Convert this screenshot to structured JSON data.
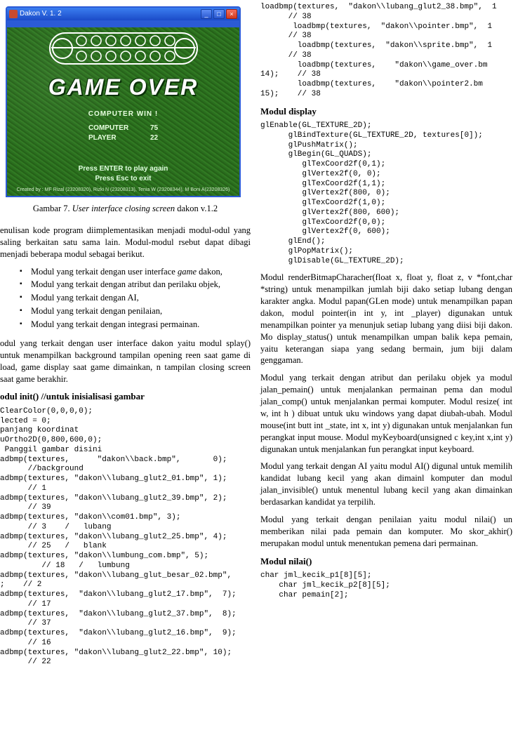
{
  "window": {
    "title": "Dakon V. 1. 2",
    "btn_min": "_",
    "btn_max": "□",
    "btn_close": "×"
  },
  "game": {
    "over": "GAME OVER",
    "winmsg": "COMPUTER WIN !",
    "score_labels": {
      "computer": "COMPUTER",
      "player": "PLAYER"
    },
    "scores": {
      "computer": "75",
      "player": "22"
    },
    "prompt1": "Press ENTER to play again",
    "prompt2": "Press Esc to exit",
    "credits": "Created by : MF Rizal (23208320), Rizki N (23208313), Tenia W (23208344), M Boni A(23208326)"
  },
  "caption_label": "Gambar 7.  ",
  "caption_text": "User interface closing screen",
  "caption_suffix": " dakon v.1.2",
  "para_intro": "enulisan kode program diimplementasikan menjadi modul-odul yang saling berkaitan satu sama lain. Modul-modul rsebut dapat dibagi menjadi beberapa modul sebagai berikut.",
  "bullets": [
    {
      "pre": "Modul yang terkait dengan user interface ",
      "ital": "game",
      "post": " dakon,"
    },
    {
      "pre": "Modul yang terkait dengan atribut dan perilaku objek,",
      "ital": "",
      "post": ""
    },
    {
      "pre": "Modul yang terkait dengan AI,",
      "ital": "",
      "post": ""
    },
    {
      "pre": "Modul yang terkait dengan penilaian,",
      "ital": "",
      "post": ""
    },
    {
      "pre": "Modul yang terkait dengan integrasi permainan.",
      "ital": "",
      "post": ""
    }
  ],
  "para_ui": "odul yang terkait dengan user interface dakon yaitu modul splay() untuk menampilkan background tampilan opening reen saat game di load, game display saat game dimainkan, n tampilan closing screen saat game berakhir.",
  "heading_init": "odul init() //untuk inisialisasi gambar",
  "code_init": "ClearColor(0,0,0,0);\nlected = 0;\npanjang koordinat\nuOrtho2D(0,800,600,0);\n Panggil gambar disini\nadbmp(textures,      \"dakon\\\\back.bmp\",       0);\n      //background\nadbmp(textures, \"dakon\\\\lubang_glut2_01.bmp\", 1);\n      // 1\nadbmp(textures, \"dakon\\\\lubang_glut2_39.bmp\", 2);\n      // 39\nadbmp(textures, \"dakon\\\\com01.bmp\", 3);\n      // 3    /   lubang\nadbmp(textures, \"dakon\\\\lubang_glut2_25.bmp\", 4);\n      // 25   /   blank\nadbmp(textures, \"dakon\\\\lumbung_com.bmp\", 5);\n         // 18   /   lumbung\nadbmp(textures, \"dakon\\\\lubang_glut_besar_02.bmp\",\n;    // 2\nadbmp(textures,  \"dakon\\\\lubang_glut2_17.bmp\",  7);\n      // 17\nadbmp(textures,  \"dakon\\\\lubang_glut2_37.bmp\",  8);\n      // 37\nadbmp(textures,  \"dakon\\\\lubang_glut2_16.bmp\",  9);\n      // 16\nadbmp(textures, \"dakon\\\\lubang_glut2_22.bmp\", 10);\n      // 22",
  "code_load_right": "loadbmp(textures,  \"dakon\\\\lubang_glut2_38.bmp\",  1\n      // 38\n       loadbmp(textures,  \"dakon\\\\pointer.bmp\",  1\n      // 38\n        loadbmp(textures,  \"dakon\\\\sprite.bmp\",  1\n      // 38\n        loadbmp(textures,    \"dakon\\\\game_over.bm\n14);    // 38\n        loadbmp(textures,    \"dakon\\\\pointer2.bm\n15);    // 38",
  "heading_display": "Modul display",
  "code_display": "glEnable(GL_TEXTURE_2D);\n      glBindTexture(GL_TEXTURE_2D, textures[0]);\n      glPushMatrix();\n      glBegin(GL_QUADS);\n         glTexCoord2f(0,1);\n         glVertex2f(0, 0);\n         glTexCoord2f(1,1);\n         glVertex2f(800, 0);\n         glTexCoord2f(1,0);\n         glVertex2f(800, 600);\n         glTexCoord2f(0,0);\n         glVertex2f(0, 600);\n      glEnd();\n      glPopMatrix();\n      glDisable(GL_TEXTURE_2D);",
  "para_render": "Modul renderBitmapCharacher(float x, float y, float z, v *font,char *string) untuk menampilkan jumlah biji dako setiap lubang dengan karakter angka. Modul papan(GLen mode) untuk menampilkan papan dakon, modul pointer(in int y, int _player) digunakan untuk menampilkan pointer ya menunjuk setiap lubang yang diisi biji dakon. Mo display_status() untuk menampilkan umpan balik kepa pemain, yaitu keterangan siapa yang sedang bermain, jum biji dalam genggaman.",
  "para_attr": "Modul yang terkait dengan atribut dan perilaku objek ya modul jalan_pemain() untuk menjalankan permainan pema dan modul jalan_comp() untuk menjalankan permai komputer. Modul resize( int w, int h ) dibuat untuk uku windows yang dapat diubah-ubah.  Modul mouse(int butt int _state, int x, int y) digunakan untuk menjalankan fun perangkat input mouse. Modul myKeyboard(unsigned c key,int x,int y) digunakan untuk menjalankan fun perangkat input keyboard.",
  "para_ai": "Modul yang terkait dengan AI yaitu modul AI() digunal untuk memilih kandidat lubang kecil yang akan dimainl komputer dan modul jalan_invisible() untuk menentul lubang kecil yang akan dimainkan berdasarkan kandidat ya terpilih.",
  "para_nilai": "Modul yang terkait dengan penilaian yaitu modul nilai() un memberikan nilai pada pemain dan komputer. Mo skor_akhir() merupakan modul untuk menentukan pemena dari permainan.",
  "heading_nilai": "Modul nilai()",
  "code_nilai": "char jml_kecik_p1[8][5];\n    char jml_kecik_p2[8][5];\n    char pemain[2];"
}
